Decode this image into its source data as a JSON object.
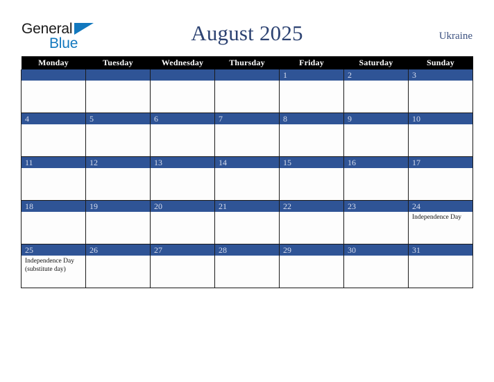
{
  "brand": {
    "word_one": "General",
    "word_two": "Blue",
    "triangle_icon": "triangle-icon",
    "color_dark": "#1b1b1b",
    "color_blue": "#1278be"
  },
  "header": {
    "title": "August 2025",
    "country": "Ukraine",
    "title_color": "#2d4372",
    "country_color": "#3c5180"
  },
  "calendar": {
    "weekday_headers": [
      "Monday",
      "Tuesday",
      "Wednesday",
      "Thursday",
      "Friday",
      "Saturday",
      "Sunday"
    ],
    "header_bg": "#000000",
    "header_text_color": "#ffffff",
    "daynum_bg": "#2f5496",
    "daynum_text_color": "#d6dced",
    "cell_bg": "#fdfdfd",
    "grid_line_color": "#1a1a1a",
    "weeks": [
      [
        {
          "date": "",
          "holiday": ""
        },
        {
          "date": "",
          "holiday": ""
        },
        {
          "date": "",
          "holiday": ""
        },
        {
          "date": "",
          "holiday": ""
        },
        {
          "date": "1",
          "holiday": ""
        },
        {
          "date": "2",
          "holiday": ""
        },
        {
          "date": "3",
          "holiday": ""
        }
      ],
      [
        {
          "date": "4",
          "holiday": ""
        },
        {
          "date": "5",
          "holiday": ""
        },
        {
          "date": "6",
          "holiday": ""
        },
        {
          "date": "7",
          "holiday": ""
        },
        {
          "date": "8",
          "holiday": ""
        },
        {
          "date": "9",
          "holiday": ""
        },
        {
          "date": "10",
          "holiday": ""
        }
      ],
      [
        {
          "date": "11",
          "holiday": ""
        },
        {
          "date": "12",
          "holiday": ""
        },
        {
          "date": "13",
          "holiday": ""
        },
        {
          "date": "14",
          "holiday": ""
        },
        {
          "date": "15",
          "holiday": ""
        },
        {
          "date": "16",
          "holiday": ""
        },
        {
          "date": "17",
          "holiday": ""
        }
      ],
      [
        {
          "date": "18",
          "holiday": ""
        },
        {
          "date": "19",
          "holiday": ""
        },
        {
          "date": "20",
          "holiday": ""
        },
        {
          "date": "21",
          "holiday": ""
        },
        {
          "date": "22",
          "holiday": ""
        },
        {
          "date": "23",
          "holiday": ""
        },
        {
          "date": "24",
          "holiday": "Independence Day"
        }
      ],
      [
        {
          "date": "25",
          "holiday": "Independence Day (substitute day)"
        },
        {
          "date": "26",
          "holiday": ""
        },
        {
          "date": "27",
          "holiday": ""
        },
        {
          "date": "28",
          "holiday": ""
        },
        {
          "date": "29",
          "holiday": ""
        },
        {
          "date": "30",
          "holiday": ""
        },
        {
          "date": "31",
          "holiday": ""
        }
      ]
    ]
  }
}
